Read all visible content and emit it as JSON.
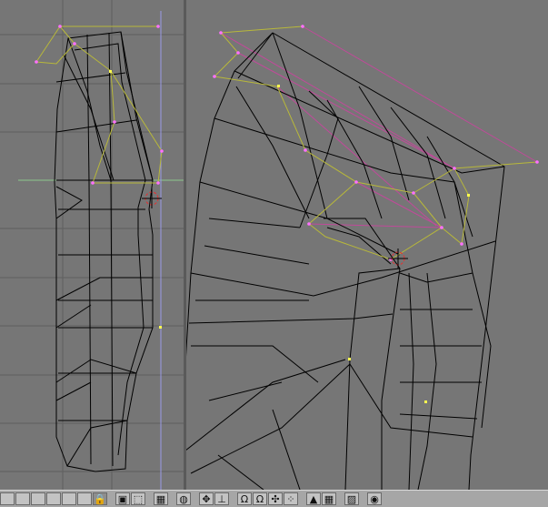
{
  "window": {
    "title": ""
  },
  "viewports": [
    {
      "name": "side-view"
    },
    {
      "name": "perspective-view"
    }
  ],
  "toolbar": {
    "buttons": [
      {
        "name": "layer-1-button",
        "glyph": ""
      },
      {
        "name": "layer-2-button",
        "glyph": ""
      },
      {
        "name": "layer-3-button",
        "glyph": ""
      },
      {
        "name": "layer-4-button",
        "glyph": ""
      },
      {
        "name": "layer-5-button",
        "glyph": ""
      },
      {
        "name": "layer-6-button",
        "glyph": ""
      },
      {
        "name": "lock-button",
        "glyph": "🔒"
      },
      {
        "name": "view-local-button",
        "glyph": "▣"
      },
      {
        "name": "draw-type-button",
        "glyph": "⬚"
      },
      {
        "name": "object-mode-button",
        "glyph": "▦"
      },
      {
        "name": "shading-button",
        "glyph": "◍"
      },
      {
        "name": "manipulator-translate-button",
        "glyph": "✥"
      },
      {
        "name": "manipulator-normal-button",
        "glyph": "⊥"
      },
      {
        "name": "proportional-edit-button",
        "glyph": "Ω"
      },
      {
        "name": "proportional-falloff-button",
        "glyph": "Ω"
      },
      {
        "name": "pivot-point-button",
        "glyph": "✣"
      },
      {
        "name": "snap-button",
        "glyph": "⁘"
      },
      {
        "name": "onion-button",
        "glyph": "▲"
      },
      {
        "name": "grid-button",
        "glyph": "▦"
      },
      {
        "name": "render-image-button",
        "glyph": "▨"
      },
      {
        "name": "render-anim-button",
        "glyph": "◉"
      }
    ]
  },
  "colors": {
    "background": "#767676",
    "mesh": "#000000",
    "cage": "#b8b83a",
    "vertex": "#ff70ff",
    "selected_vertex": "#ffff50"
  }
}
